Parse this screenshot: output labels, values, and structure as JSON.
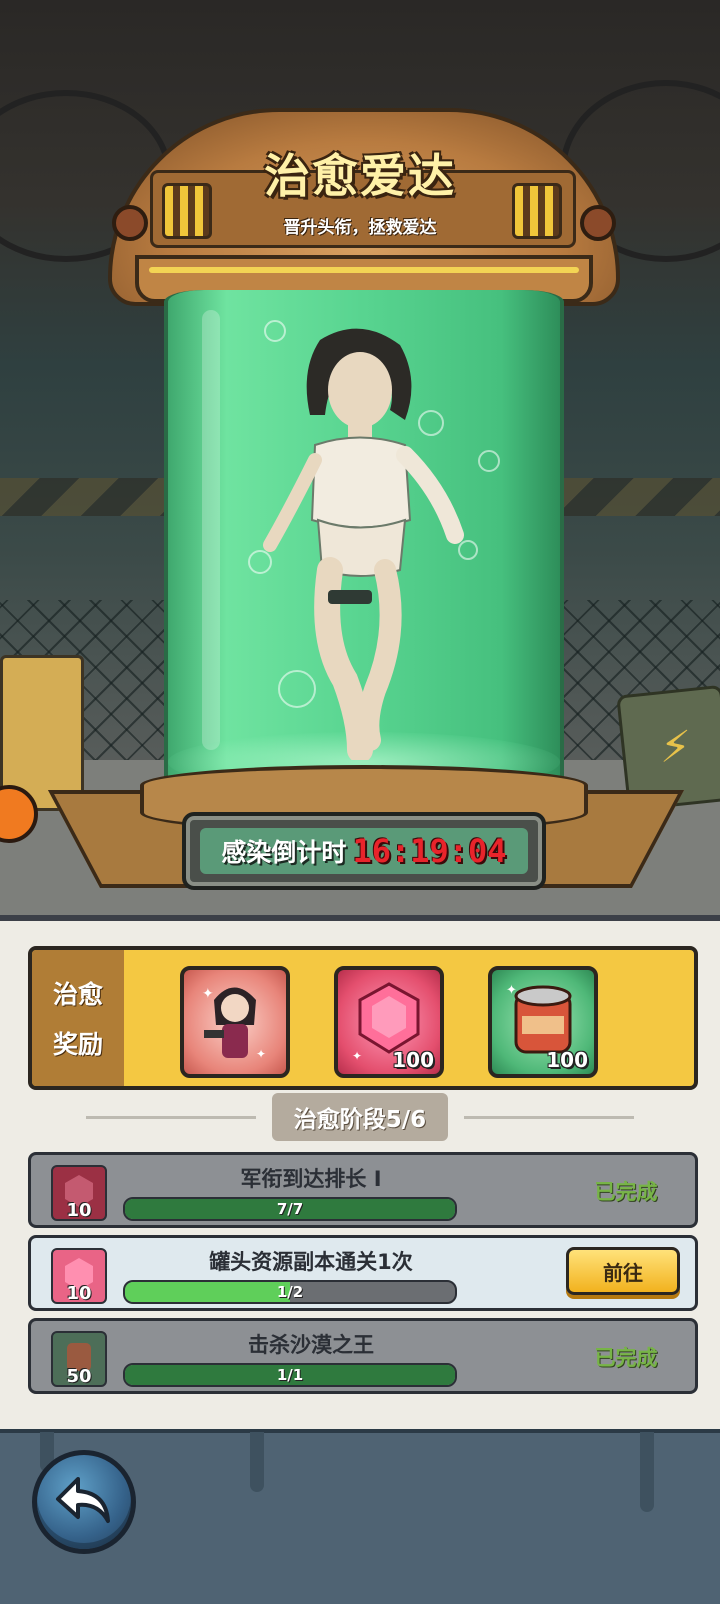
{
  "header": {
    "title": "治愈爱达",
    "subtitle": "晋升头衔，拯救爱达"
  },
  "countdown": {
    "label": "感染倒计时",
    "value": "16:19:04"
  },
  "rewards": {
    "label_line1": "治愈",
    "label_line2": "奖励",
    "items": [
      {
        "icon": "character-icon",
        "qty": ""
      },
      {
        "icon": "gem-icon",
        "qty": "100"
      },
      {
        "icon": "canned-food-icon",
        "qty": "100"
      }
    ]
  },
  "stage": {
    "label": "治愈阶段5/6"
  },
  "tasks": [
    {
      "title": "军衔到达排长 Ⅰ",
      "progress": "7/7",
      "fraction": 1.0,
      "reward_qty": "10",
      "reward_icon": "gem-icon",
      "status": "已完成"
    },
    {
      "title": "罐头资源副本通关1次",
      "progress": "1/2",
      "fraction": 0.5,
      "reward_qty": "10",
      "reward_icon": "gem-icon",
      "button": "前往"
    },
    {
      "title": "击杀沙漠之王",
      "progress": "1/1",
      "fraction": 1.0,
      "reward_qty": "50",
      "reward_icon": "canned-food-icon",
      "status": "已完成"
    }
  ],
  "colors": {
    "tube_green": "#58d490",
    "countdown_red": "#e8242b",
    "reward_bar": "#f4c842",
    "done_stamp": "#77b447",
    "go_button": "#f2b21e"
  }
}
